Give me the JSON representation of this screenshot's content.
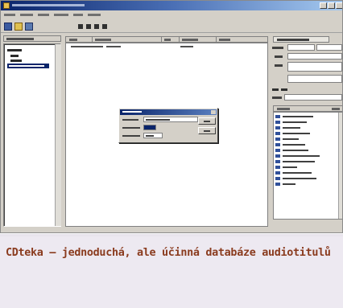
{
  "caption": {
    "text": "CDteka – jednoduchá, ale účinná databáze audiotitulů"
  },
  "colors": {
    "caption_text": "#8a3b1e",
    "caption_background": "#ede9f1",
    "window_chrome": "#d4d0c8",
    "titlebar_active": "#0a246a",
    "selection": "#0a246a"
  },
  "icons": {
    "app": "app-icon",
    "save": "disk-icon",
    "open": "folder-icon",
    "grid": "grid-icon",
    "track": "music-note-icon"
  }
}
